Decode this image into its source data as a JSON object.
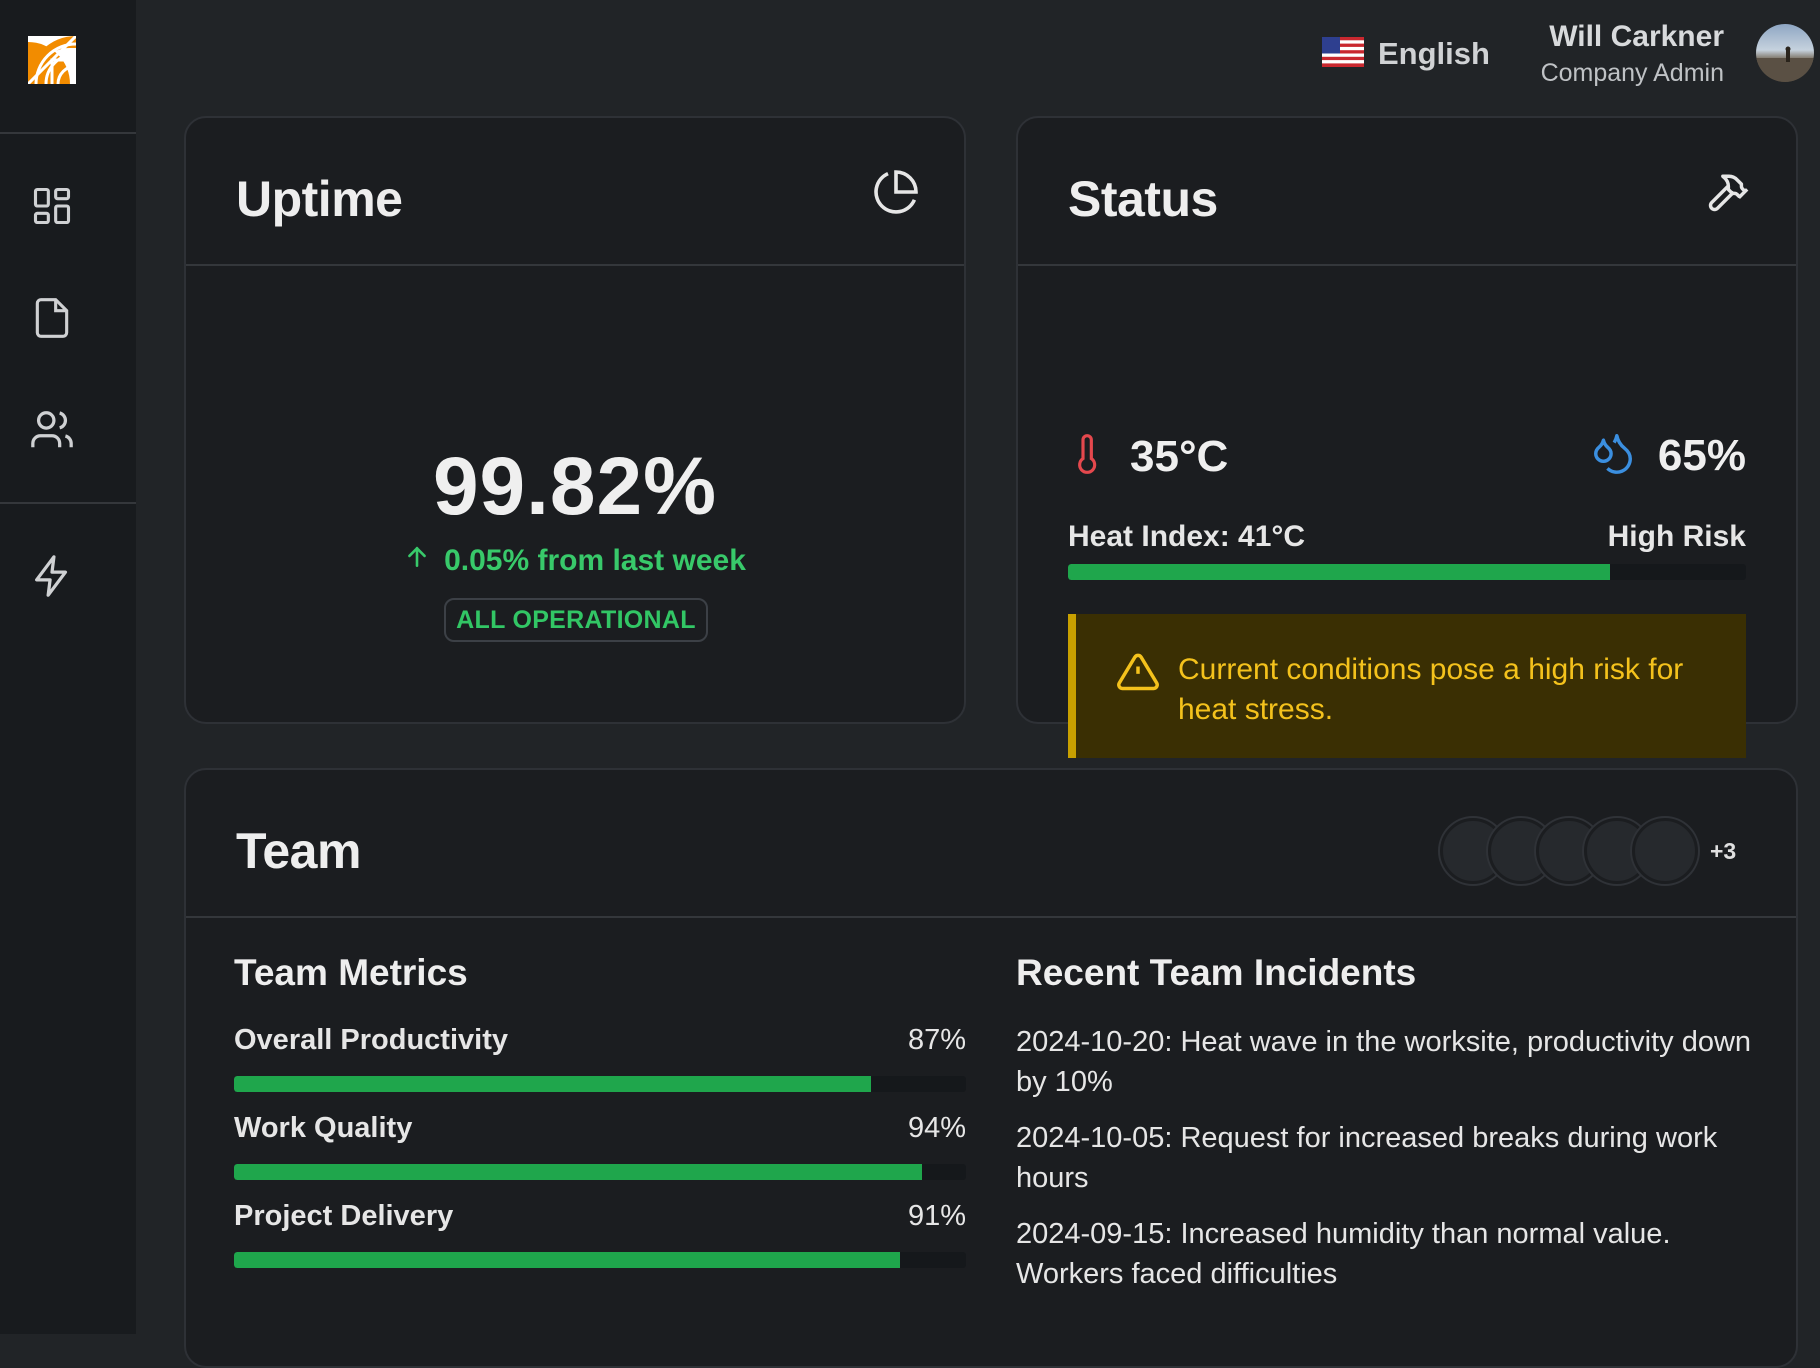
{
  "user": {
    "name": "Will Carkner",
    "role": "Company Admin"
  },
  "language": {
    "label": "English",
    "flag_icon": "us-flag-icon"
  },
  "sidebar": {
    "items": [
      {
        "icon": "dashboard-grid-icon"
      },
      {
        "icon": "document-icon"
      },
      {
        "icon": "users-icon"
      },
      {
        "icon": "lightning-icon"
      }
    ]
  },
  "uptime": {
    "title": "Uptime",
    "value": "99.82%",
    "change": "0.05% from last week",
    "badge": "ALL OPERATIONAL"
  },
  "status": {
    "title": "Status",
    "temperature": "35°C",
    "humidity": "65%",
    "heat_index": "Heat Index: 41°C",
    "risk": "High Risk",
    "risk_level": 0.8,
    "alert": "Current conditions pose a high risk for heat stress."
  },
  "team": {
    "title": "Team",
    "more": "+3",
    "metrics_title": "Team Metrics",
    "metrics": [
      {
        "label": "Overall Productivity",
        "value": "87%",
        "fraction": 0.87
      },
      {
        "label": "Work Quality",
        "value": "94%",
        "fraction": 0.94
      },
      {
        "label": "Project Delivery",
        "value": "91%",
        "fraction": 0.91
      }
    ],
    "incidents_title": "Recent Team Incidents",
    "incidents": [
      "2024-10-20: Heat wave in the worksite, productivity down by 10%",
      "2024-10-05: Request for increased breaks during work hours",
      "2024-09-15: Increased humidity than normal value. Workers faced difficulties"
    ]
  },
  "colors": {
    "accent_green": "#1fa64c",
    "alert_yellow": "#f4c21c",
    "temperature_red": "#e5484d",
    "humidity_blue": "#3b8fe0",
    "logo_orange": "#f28c00"
  }
}
